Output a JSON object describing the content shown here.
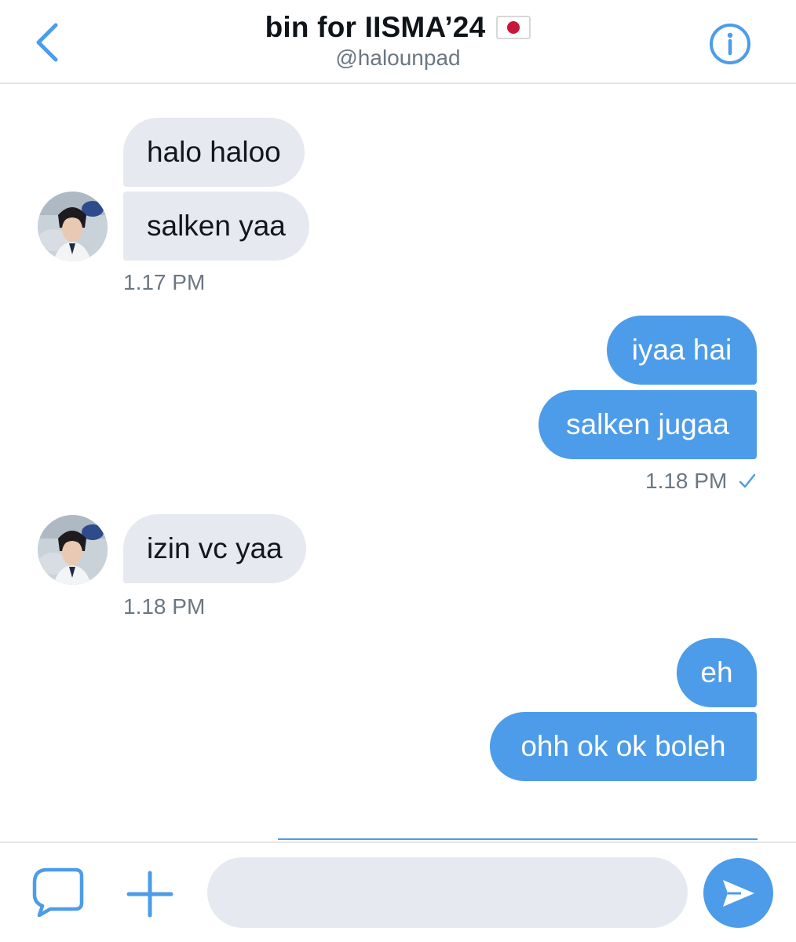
{
  "header": {
    "title": "bin for IISMA’24",
    "flag_icon": "japan-flag-icon",
    "handle": "@halounpad",
    "back_icon": "chevron-left-icon",
    "info_icon": "info-icon"
  },
  "messages": [
    {
      "sender": "them",
      "text": "halo haloo"
    },
    {
      "sender": "them",
      "text": "salken yaa"
    },
    {
      "sender": "them",
      "time": "1.17 PM"
    },
    {
      "sender": "me",
      "text": "iyaa hai"
    },
    {
      "sender": "me",
      "text": "salken jugaa"
    },
    {
      "sender": "me",
      "time": "1.18 PM",
      "status_icon": "checkmark-icon"
    },
    {
      "sender": "them",
      "text": "izin vc yaa"
    },
    {
      "sender": "them",
      "time": "1.18 PM"
    },
    {
      "sender": "me",
      "text": "eh"
    },
    {
      "sender": "me",
      "text": "ohh ok ok boleh"
    }
  ],
  "composer": {
    "placeholder": "",
    "value": "",
    "icons": [
      "dm-bubble-icon",
      "plus-icon",
      "send-icon"
    ]
  },
  "colors": {
    "accent": "#4d9ce9",
    "incoming_bubble": "#e6e9ef",
    "secondary_text": "#6b7782"
  }
}
